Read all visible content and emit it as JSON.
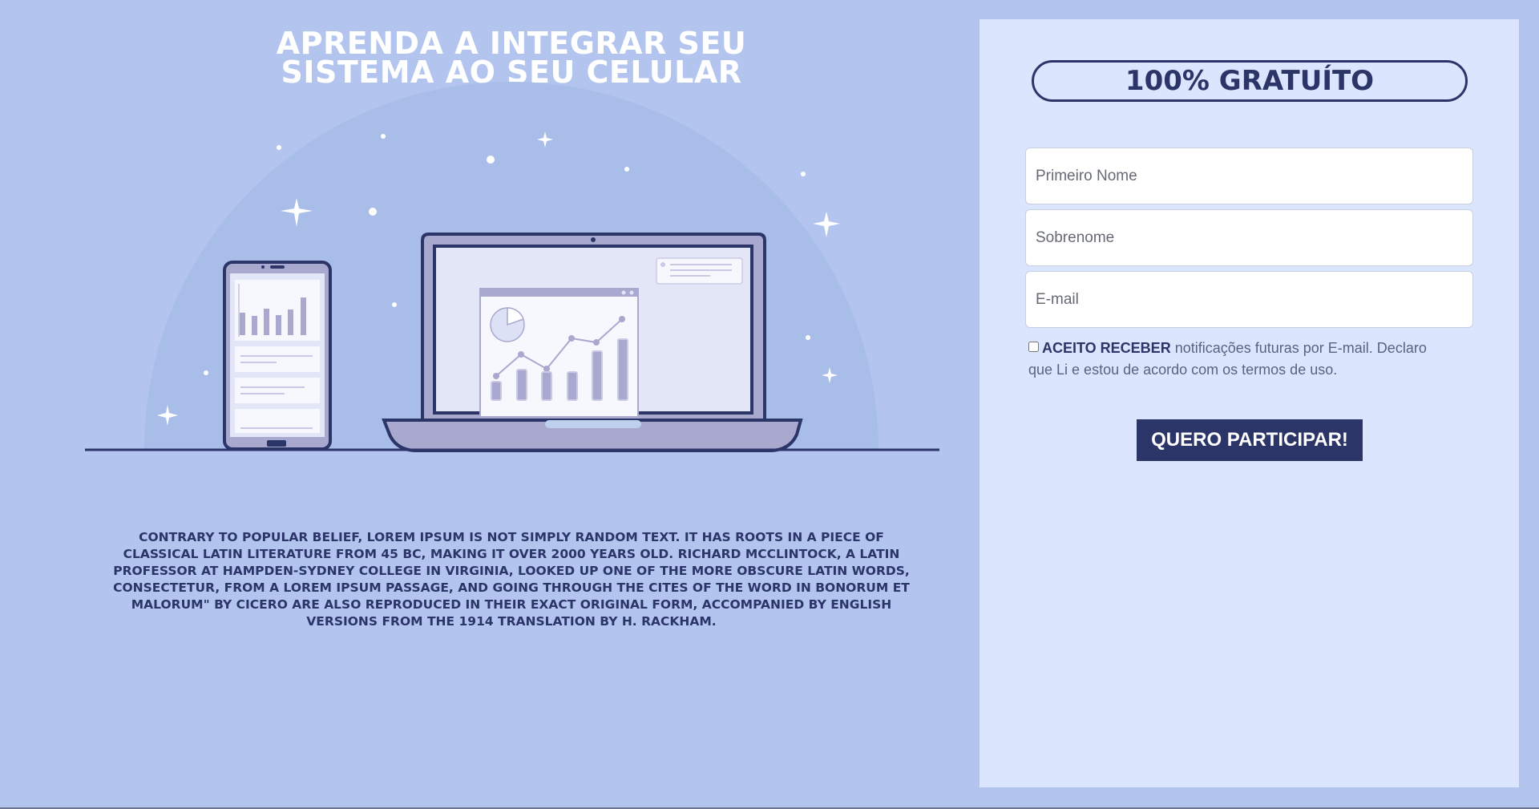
{
  "hero": {
    "headline_line1": "APRENDA A INTEGRAR SEU",
    "headline_line2": "SISTEMA AO SEU CELULAR",
    "body": "CONTRARY TO POPULAR BELIEF, LOREM IPSUM IS NOT SIMPLY RANDOM TEXT. IT HAS ROOTS IN A PIECE OF CLASSICAL LATIN LITERATURE FROM 45 BC, MAKING IT OVER 2000 YEARS OLD. RICHARD MCCLINTOCK, A LATIN PROFESSOR AT HAMPDEN-SYDNEY COLLEGE IN VIRGINIA, LOOKED UP ONE OF THE MORE OBSCURE LATIN WORDS, CONSECTETUR, FROM A LOREM IPSUM PASSAGE, AND GOING THROUGH THE CITES OF THE WORD IN BONORUM ET MALORUM\" BY CICERO ARE ALSO REPRODUCED IN THEIR EXACT ORIGINAL FORM, ACCOMPANIED BY ENGLISH VERSIONS FROM THE 1914 TRANSLATION BY H. RACKHAM."
  },
  "form": {
    "badge": "100% GRATUÍTO",
    "first_name_placeholder": "Primeiro Nome",
    "last_name_placeholder": "Sobrenome",
    "email_placeholder": "E-mail",
    "consent_bold": "ACEITO RECEBER",
    "consent_text": " notificações futuras por E-mail. Declaro que Li e estou de acordo com os termos de uso.",
    "consent_checked": false,
    "submit_label": "QUERO PARTICIPAR!"
  },
  "colors": {
    "background": "#b3c5ef",
    "panel": "#dbe5fe",
    "accent": "#2b3568",
    "device_fill": "#a9a8cf",
    "screen_fill": "#e3e6f6"
  }
}
